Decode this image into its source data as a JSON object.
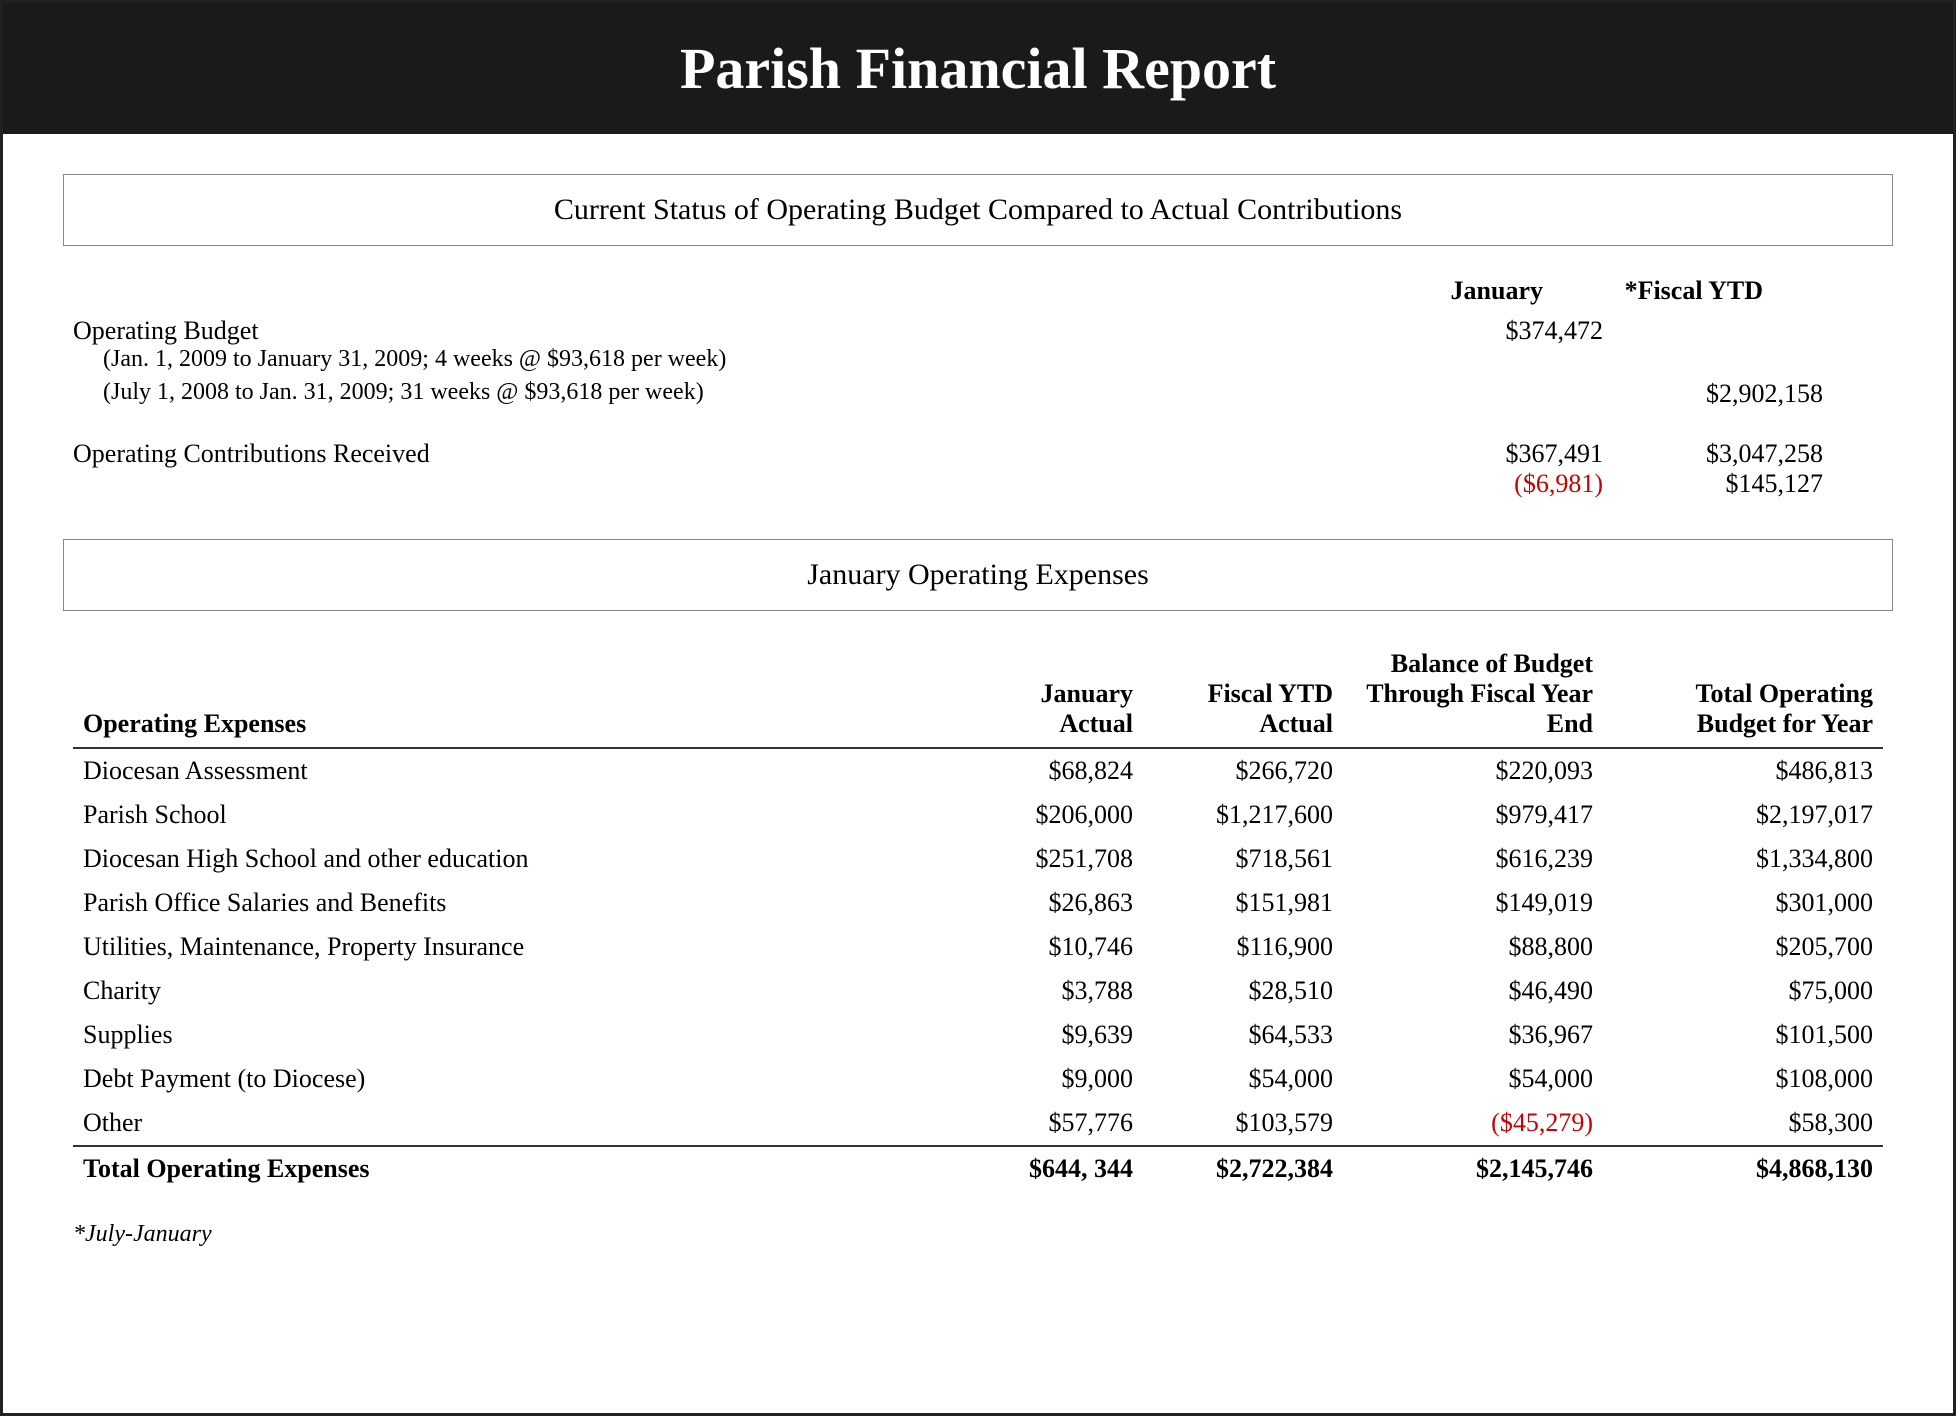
{
  "header": {
    "title": "Parish Financial Report"
  },
  "section1": {
    "title": "Current Status of Operating Budget Compared to Actual Contributions",
    "col_january": "January",
    "col_fiscal_ytd": "*Fiscal YTD",
    "operating_budget_label": "Operating Budget",
    "ob_sub1": "(Jan. 1, 2009 to January 31, 2009; 4 weeks @ $93,618 per week)",
    "ob_sub1_jan": "$374,472",
    "ob_sub2": "(July 1, 2008 to Jan. 31, 2009; 31 weeks @ $93,618 per week)",
    "ob_sub2_ytd": "$2,902,158",
    "contributions_label": "Operating Contributions Received",
    "contrib_jan": "$367,491",
    "contrib_jan_diff": "($6,981)",
    "contrib_ytd": "$3,047,258",
    "contrib_ytd_diff": "$145,127"
  },
  "section2": {
    "title": "January Operating Expenses",
    "col_label": "Operating Expenses",
    "col_jan_actual": "January Actual",
    "col_fiscal_ytd": "Fiscal YTD Actual",
    "col_balance": "Balance of Budget Through Fiscal Year End",
    "col_total": "Total Operating Budget for Year",
    "rows": [
      {
        "label": "Diocesan Assessment",
        "jan_actual": "$68,824",
        "fiscal_ytd": "$266,720",
        "balance": "$220,093",
        "total": "$486,813",
        "red_balance": false
      },
      {
        "label": "Parish School",
        "jan_actual": "$206,000",
        "fiscal_ytd": "$1,217,600",
        "balance": "$979,417",
        "total": "$2,197,017",
        "red_balance": false
      },
      {
        "label": "Diocesan High School and other education",
        "jan_actual": "$251,708",
        "fiscal_ytd": "$718,561",
        "balance": "$616,239",
        "total": "$1,334,800",
        "red_balance": false
      },
      {
        "label": "Parish Office Salaries and Benefits",
        "jan_actual": "$26,863",
        "fiscal_ytd": "$151,981",
        "balance": "$149,019",
        "total": "$301,000",
        "red_balance": false
      },
      {
        "label": "Utilities, Maintenance, Property Insurance",
        "jan_actual": "$10,746",
        "fiscal_ytd": "$116,900",
        "balance": "$88,800",
        "total": "$205,700",
        "red_balance": false
      },
      {
        "label": "Charity",
        "jan_actual": "$3,788",
        "fiscal_ytd": "$28,510",
        "balance": "$46,490",
        "total": "$75,000",
        "red_balance": false
      },
      {
        "label": "Supplies",
        "jan_actual": "$9,639",
        "fiscal_ytd": "$64,533",
        "balance": "$36,967",
        "total": "$101,500",
        "red_balance": false
      },
      {
        "label": "Debt Payment (to Diocese)",
        "jan_actual": "$9,000",
        "fiscal_ytd": "$54,000",
        "balance": "$54,000",
        "total": "$108,000",
        "red_balance": false
      },
      {
        "label": "Other",
        "jan_actual": "$57,776",
        "fiscal_ytd": "$103,579",
        "balance": "($45,279)",
        "total": "$58,300",
        "red_balance": true
      }
    ],
    "total_row": {
      "label": "Total Operating Expenses",
      "jan_actual": "$644, 344",
      "fiscal_ytd": "$2,722,384",
      "balance": "$2,145,746",
      "total": "$4,868,130"
    },
    "footnote": "*July-January"
  }
}
